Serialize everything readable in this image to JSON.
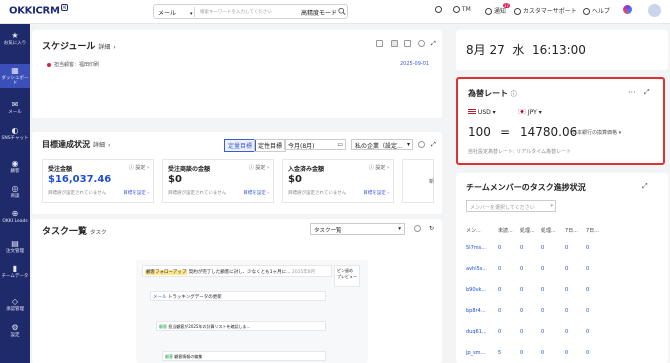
{
  "header": {
    "logo": "OKKICRM",
    "logo_badge": "AI",
    "search_select": "メール",
    "search_placeholder": "検索キーワードを入力してください",
    "search_mode": "高精度モード",
    "user_short": "TM",
    "notifications_label": "通知",
    "notifications_count": "17",
    "support_label": "カスタマーサポート",
    "help_label": "ヘルプ"
  },
  "sidebar": {
    "items": [
      {
        "label": "お気に入り",
        "icon": "star-icon"
      },
      {
        "label": "ダッシュボード",
        "icon": "dashboard-icon"
      },
      {
        "label": "メール",
        "icon": "mail-icon"
      },
      {
        "label": "SNSチャット",
        "icon": "chat-icon"
      },
      {
        "label": "顧客",
        "icon": "customer-icon"
      },
      {
        "label": "商談",
        "icon": "deal-icon"
      },
      {
        "label": "OKKI Leads",
        "icon": "leads-icon"
      },
      {
        "label": "注文管理",
        "icon": "order-icon"
      },
      {
        "label": "チームデータ",
        "icon": "team-data-icon"
      },
      {
        "label": "承認管理",
        "icon": "approval-icon"
      },
      {
        "label": "設定",
        "icon": "settings-icon"
      }
    ]
  },
  "schedule": {
    "title": "スケジュール",
    "detail": "詳細",
    "owner": "担当顧客：福田印刷",
    "date": "2025-09-01"
  },
  "goals": {
    "title": "目標達成状況",
    "detail": "詳細",
    "tabs": [
      "定量目標",
      "定性目標"
    ],
    "period": "今月(8月)",
    "company": "私の企業（設定...",
    "cards": [
      {
        "title": "受注金額",
        "settings": "設定",
        "value": "$16,037.46",
        "note": "目標値が設定されていません",
        "link": "目標を設定"
      },
      {
        "title": "受注商談の金額",
        "settings": "設定",
        "value": "$0",
        "note": "目標値が設定されていません",
        "link": "目標を設定"
      },
      {
        "title": "入金済み金額",
        "settings": "設定",
        "value": "$0",
        "note": "目標値が設定されていません",
        "link": "目標を設定"
      }
    ],
    "more": "新"
  },
  "tasks": {
    "title": "タスク一覧",
    "subtitle": "タスク",
    "select": "タスク一覧",
    "preview": {
      "row1_tag": "顧客フォローアップ",
      "row1_text": "契約が完了した顧客に対し、少なくとも1ヶ月に...",
      "row1_date": "2025年8月",
      "row2_tag": "メール",
      "row2_text": "トラッキングデータの更新",
      "row3_tag": "顧客",
      "row3_text": "担当顧客が2025年の計算リストを確認しま...",
      "row4_tag": "顧客",
      "row4_text": "顧客情報の編集",
      "side1": "ピン留め",
      "side2": "プレビュー"
    }
  },
  "clock": {
    "date": "8月 27",
    "weekday": "水",
    "time": "16:13:00"
  },
  "fx": {
    "title": "為替レート",
    "from": "USD",
    "to": "JPY",
    "amount": "100",
    "equals": "=",
    "result": "14780.06",
    "source": "日本銀行の換算価格",
    "footer": "自社設定為替レート: リアルタイム為替レート"
  },
  "team": {
    "title": "チームメンバーのタスク進捗状況",
    "select_placeholder": "メンバーを選択してください",
    "columns": [
      "メン...",
      "未読...",
      "処理...",
      "処理...",
      "7日...",
      "7日..."
    ],
    "rows": [
      [
        "5l7ms...",
        "0",
        "0",
        "0",
        "0",
        "0"
      ],
      [
        "avhi5s...",
        "0",
        "0",
        "0",
        "0",
        "0"
      ],
      [
        "b90vk...",
        "0",
        "0",
        "0",
        "0",
        "0"
      ],
      [
        "bp8r4...",
        "0",
        "0",
        "0",
        "0",
        "0"
      ],
      [
        "duq61...",
        "0",
        "0",
        "0",
        "0",
        "0"
      ],
      [
        "jp_sm...",
        "5",
        "0",
        "0",
        "0",
        "0"
      ]
    ]
  }
}
